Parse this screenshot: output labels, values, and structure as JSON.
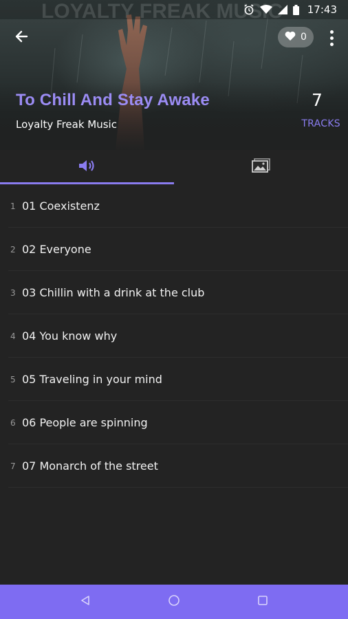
{
  "status_bar": {
    "time": "17:43",
    "icons": [
      "alarm-icon",
      "wifi-icon",
      "signal-icon",
      "battery-icon"
    ]
  },
  "header": {
    "back_icon": "arrow-left-icon",
    "like_icon": "heart-icon",
    "like_count": "0",
    "more_icon": "more-vertical-icon"
  },
  "album": {
    "title": "To Chill And Stay Awake",
    "artist": "Loyalty Freak Music",
    "track_count": "7",
    "tracks_label": "TRACKS"
  },
  "tabs": [
    {
      "icon": "speaker-icon",
      "active": true
    },
    {
      "icon": "image-icon",
      "active": false
    }
  ],
  "tracks": [
    {
      "number": "1",
      "title": "01 Coexistenz"
    },
    {
      "number": "2",
      "title": "02 Everyone"
    },
    {
      "number": "3",
      "title": "03 Chillin with a drink at the club"
    },
    {
      "number": "4",
      "title": "04 You know why"
    },
    {
      "number": "5",
      "title": "05 Traveling in your mind"
    },
    {
      "number": "6",
      "title": "06 People are spinning"
    },
    {
      "number": "7",
      "title": "07 Monarch of the street"
    }
  ],
  "nav_bar": {
    "icons": [
      "back-triangle-icon",
      "home-circle-icon",
      "recents-square-icon"
    ]
  },
  "colors": {
    "accent": "#8a7cf0",
    "nav_bar": "#7e6cf2",
    "background": "#232323",
    "title": "#9b8cf4"
  }
}
